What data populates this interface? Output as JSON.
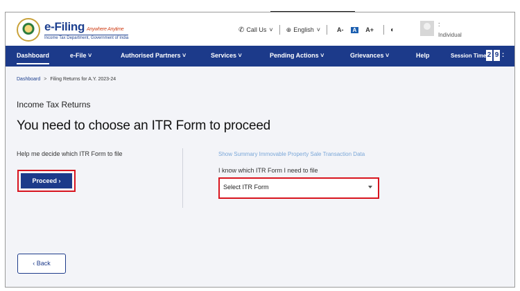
{
  "header": {
    "brand_name": "e-Filing",
    "brand_tagline": "Anywhere Anytime",
    "brand_dept": "Income Tax Department, Government of India",
    "call_us": "Call Us",
    "language": "English",
    "font_small": "A-",
    "font_normal": "A",
    "font_large": "A+",
    "user_colon": ":",
    "user_role": "Individual"
  },
  "nav": {
    "items": [
      "Dashboard",
      "e-File ˅",
      "Authorised Partners ˅",
      "Services ˅",
      "Pending Actions ˅",
      "Grievances ˅",
      "Help"
    ],
    "session_label": "Session Time",
    "timer": [
      "2",
      "9",
      ":"
    ]
  },
  "breadcrumb": {
    "home": "Dashboard",
    "separator": ">",
    "current": "Filing Returns for A.Y. 2023-24"
  },
  "page": {
    "section_label": "Income Tax Returns",
    "heading": "You need to choose an ITR Form to proceed",
    "left_label": "Help me decide which ITR Form to file",
    "proceed_label": "Proceed  ›",
    "summary_link": "Show Summary Immovable Property Sale Transaction Data",
    "right_label": "I know which ITR Form I need to file",
    "select_value": "Select ITR Form",
    "back_label": "‹  Back"
  },
  "colors": {
    "nav_bg": "#1c3a8a",
    "highlight_border": "#d8141e",
    "content_bg": "#f3f4f8"
  }
}
